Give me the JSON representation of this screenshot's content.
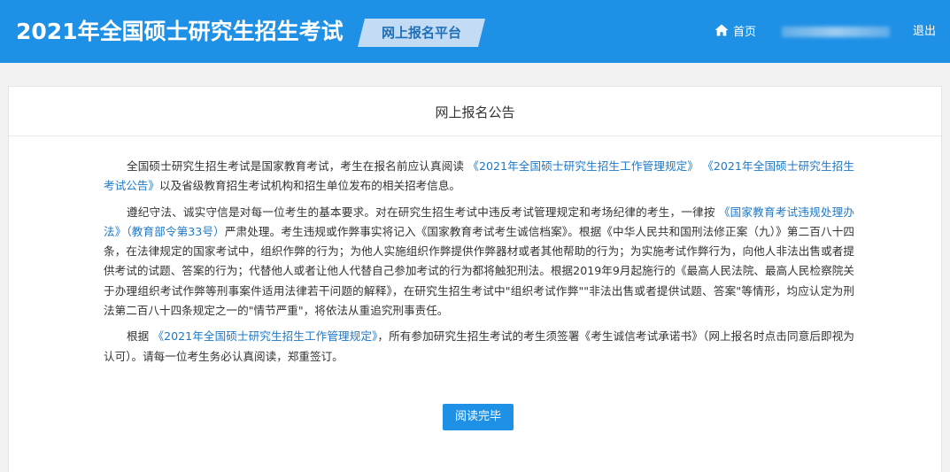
{
  "header": {
    "site_title": "2021年全国硕士研究生招生考试",
    "platform_label": "网上报名平台",
    "home_label": "首页",
    "logout_label": "退出"
  },
  "notice": {
    "title": "网上报名公告",
    "p1": {
      "t1": "全国硕士研究生招生考试是国家教育考试，考生在报名前应认真阅读 ",
      "link1": "《2021年全国硕士研究生招生工作管理规定》",
      "t2": " ",
      "link2": "《2021年全国硕士研究生招生考试公告》",
      "t3": "以及省级教育招生考试机构和招生单位发布的相关招考信息。"
    },
    "p2": {
      "t1": "遵纪守法、诚实守信是对每一位考生的基本要求。对在研究生招生考试中违反考试管理规定和考场纪律的考生，一律按 ",
      "link1": "《国家教育考试违规处理办法》（教育部令第33号）",
      "t2": "严肃处理。考生违规或作弊事实将记入《国家教育考试考生诚信档案》。根据《中华人民共和国刑法修正案（九）》第二百八十四条，在法律规定的国家考试中，组织作弊的行为；为他人实施组织作弊提供作弊器材或者其他帮助的行为；为实施考试作弊行为，向他人非法出售或者提供考试的试题、答案的行为；代替他人或者让他人代替自己参加考试的行为都将触犯刑法。根据2019年9月起施行的《最高人民法院、最高人民检察院关于办理组织考试作弊等刑事案件适用法律若干问题的解释》，在研究生招生考试中\"组织考试作弊\"\"非法出售或者提供试题、答案\"等情形，均应认定为刑法第二百八十四条规定之一的\"情节严重\"，将依法从重追究刑事责任。"
    },
    "p3": {
      "t1": "根据 ",
      "link1": "《2021年全国硕士研究生招生工作管理规定》",
      "t2": "，所有参加研究生招生考试的考生须签署《考生诚信考试承诺书》（网上报名时点击同意后即视为认可）。请每一位考生务必认真阅读，郑重签订。"
    },
    "button_label": "阅读完毕"
  },
  "colors": {
    "header_bg": "#1e91e6",
    "badge_bg": "#c3dcf3",
    "link": "#1e78c8",
    "button_bg": "#1e91e6"
  },
  "icons": {
    "home": "home-icon"
  }
}
